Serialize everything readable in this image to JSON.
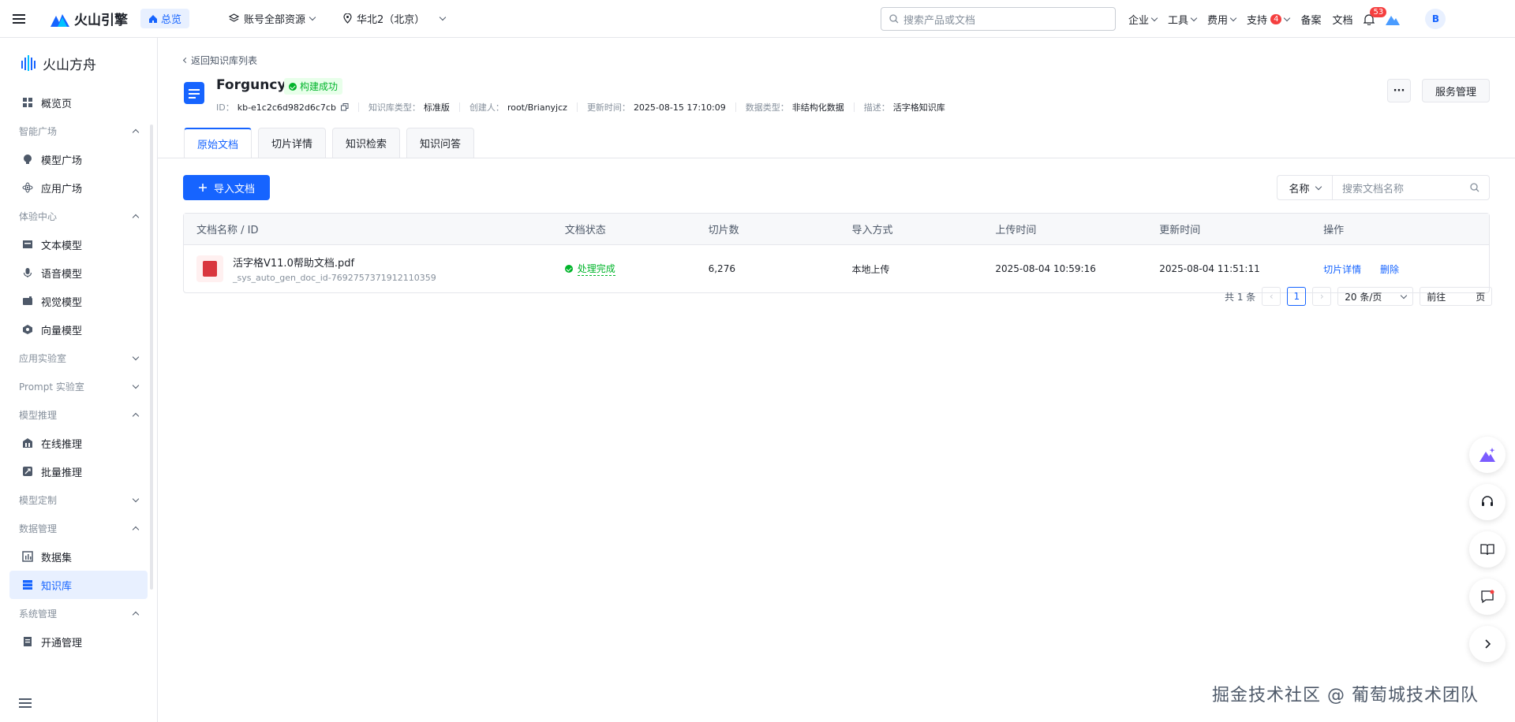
{
  "topbar": {
    "brand": "火山引擎",
    "overview": "总览",
    "account_select": "账号全部资源",
    "region_select": "华北2（北京）",
    "search_placeholder": "搜索产品或文档",
    "nav": {
      "enterprise": "企业",
      "tools": "工具",
      "billing": "费用",
      "support": "支持",
      "support_badge": "4",
      "beian": "备案",
      "docs": "文档",
      "notify_badge": "53"
    },
    "avatar": "B"
  },
  "sidebar": {
    "title": "火山方舟",
    "overview": "概览页",
    "groups": {
      "smart_plaza": "智能广场",
      "experience": "体验中心",
      "app_lab": "应用实验室",
      "prompt_lab": "Prompt 实验室",
      "inference": "模型推理",
      "customize": "模型定制",
      "data": "数据管理",
      "system": "系统管理"
    },
    "items": {
      "model_plaza": "模型广场",
      "app_plaza": "应用广场",
      "text_model": "文本模型",
      "voice_model": "语音模型",
      "vision_model": "视觉模型",
      "vector_model": "向量模型",
      "online_inference": "在线推理",
      "batch_inference": "批量推理",
      "dataset": "数据集",
      "knowledge_base": "知识库",
      "activation": "开通管理"
    }
  },
  "main": {
    "back_link": "返回知识库列表",
    "kb_name": "Forguncy",
    "kb_status": "构建成功",
    "meta": {
      "id_label": "ID：",
      "id_value": "kb-e1c2c6d982d6c7cb",
      "type_label": "知识库类型：",
      "type_value": "标准版",
      "creator_label": "创建人：",
      "creator_value": "root/Brianyjcz",
      "updated_label": "更新时间：",
      "updated_value": "2025-08-15 17:10:09",
      "data_type_label": "数据类型：",
      "data_type_value": "非结构化数据",
      "desc_label": "描述：",
      "desc_value": "活字格知识库"
    },
    "more_btn": "···",
    "service_btn": "服务管理",
    "tabs": [
      "原始文档",
      "切片详情",
      "知识检索",
      "知识问答"
    ],
    "import_btn": "导入文档",
    "search_select": "名称",
    "search_placeholder": "搜索文档名称",
    "table": {
      "headers": [
        "文档名称 / ID",
        "文档状态",
        "切片数",
        "导入方式",
        "上传时间",
        "更新时间",
        "操作"
      ],
      "row": {
        "name": "活字格V11.0帮助文档.pdf",
        "id": "_sys_auto_gen_doc_id-7692757371912110359",
        "status": "处理完成",
        "slices": "6,276",
        "import_method": "本地上传",
        "uploaded": "2025-08-04 10:59:16",
        "updated": "2025-08-04 11:51:11",
        "op_detail": "切片详情",
        "op_delete": "删除"
      }
    },
    "pager": {
      "total": "共 1 条",
      "current": "1",
      "page_size": "20 条/页",
      "goto": "前往",
      "page_unit": "页"
    }
  },
  "watermark": "掘金技术社区 @ 葡萄城技术团队"
}
